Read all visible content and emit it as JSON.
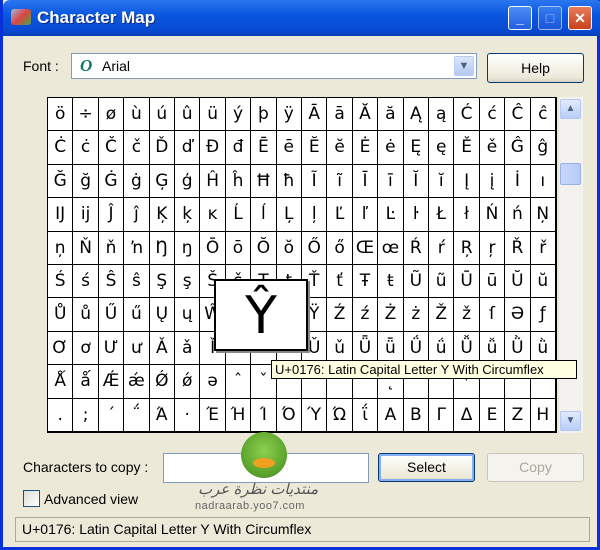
{
  "window": {
    "title": "Character Map",
    "minimize": "_",
    "maximize": "□",
    "close": "✕"
  },
  "font": {
    "label": "Font :",
    "value": "Arial",
    "icon": "opentype-font-icon",
    "icon_glyph": "O"
  },
  "help_label": "Help",
  "grid_rows": [
    "ö÷øùúûüýþÿĀāĂăĄąĆćĈĉ",
    "ĊċČčĎďĐđĒēĔĕĖėĘęĚěĜĝ",
    "ĞğĠġĢģĤĥĦħĨĩĪīĬĭĮįİı",
    "ĲĳĴĵĶķĸĹĺĻļĽľĿŀŁłŃńŅ",
    "ņŇňŉŊŋŌōŎŏŐőŒœŔŕŖŗŘř",
    "ŚśŜŝŞşŠšŢţŤťŦŧŨũŪūŬŭ",
    "ŮůŰűŲųŴŵŶŷŸŹźŻżŽžſƏƒ",
    "ƠơƯưǍǎǏǐǑǒǓǔǕǖǗǘǙǚǛǜ",
    "ǺǻǼǽǾǿəˆˇˉ˘˙˚˛˜˝ˀ˂˃˄",
    ".;΄΅Ά·ΈΉΊΌΎΏΐΑΒΓΔΕΖΗ"
  ],
  "magnified_char": "Ŷ",
  "tooltip": "U+0176: Latin Capital Letter Y With Circumflex",
  "copy": {
    "label": "Characters to copy :",
    "value": "",
    "select_label": "Select",
    "copy_label": "Copy"
  },
  "advanced_view": {
    "label": "Advanced view",
    "checked": false
  },
  "status": "U+0176: Latin Capital Letter Y With Circumflex",
  "watermark": {
    "arabic": "منتديات نظرة عرب",
    "url": "nadraarab.yoo7.com"
  }
}
